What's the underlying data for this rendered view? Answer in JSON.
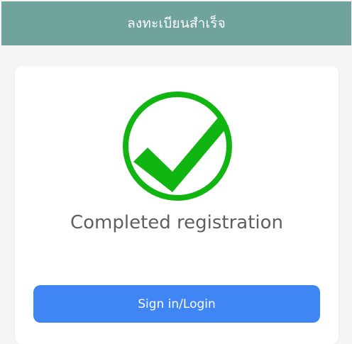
{
  "header": {
    "title": "ลงทะเบียนสำเร็จ"
  },
  "main": {
    "status_icon": "success-check-icon",
    "message": "Completed registration",
    "primary_button_label": "Sign in/Login"
  },
  "colors": {
    "header_bg": "#6fa39b",
    "success": "#11b511",
    "button_bg": "#3f86f4",
    "text": "#5f5f5f"
  }
}
